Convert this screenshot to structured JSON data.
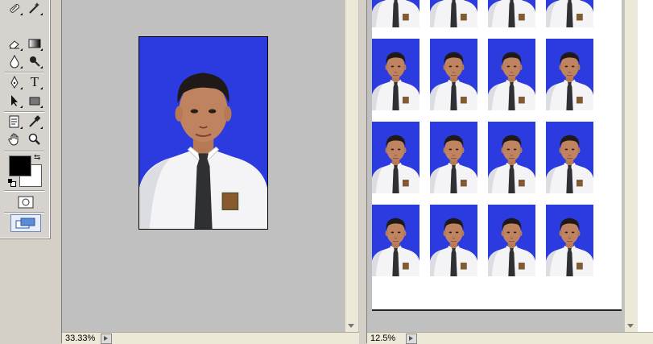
{
  "toolbox": {
    "tools": [
      {
        "icon": "healing-brush-icon"
      },
      {
        "icon": "magic-brush-icon"
      },
      {
        "icon": "eraser-icon"
      },
      {
        "icon": "gradient-icon"
      },
      {
        "icon": "blur-icon"
      },
      {
        "icon": "burn-icon"
      },
      {
        "icon": "pen-icon"
      },
      {
        "icon": "type-icon",
        "glyph": "T"
      },
      {
        "icon": "path-select-icon"
      },
      {
        "icon": "rectangle-shape-icon"
      },
      {
        "icon": "notes-icon"
      },
      {
        "icon": "eyedropper-icon"
      },
      {
        "icon": "hand-icon"
      },
      {
        "icon": "zoom-icon"
      }
    ],
    "foreground_color": "#000000",
    "background_color": "#ffffff"
  },
  "document1": {
    "zoom": "33.33%",
    "photo_background": "#2c3be0"
  },
  "document2": {
    "zoom": "12.5%",
    "grid_rows": 4,
    "grid_cols": 4
  }
}
